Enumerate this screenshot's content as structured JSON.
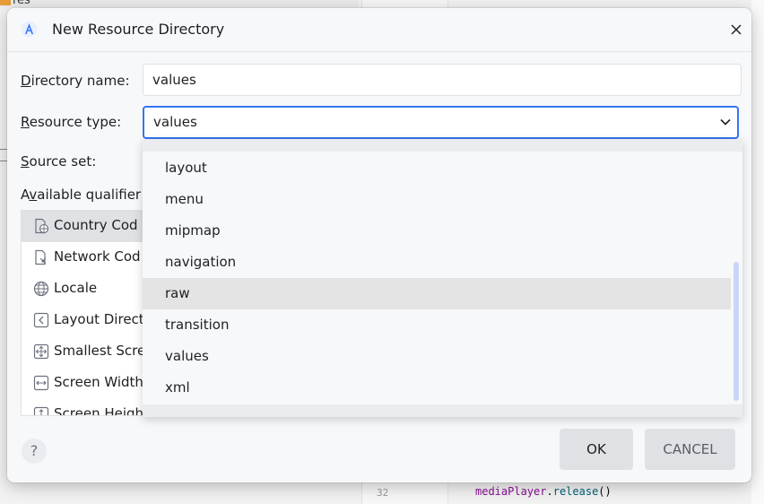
{
  "background": {
    "project_folder": "res",
    "gutter_line_number": "32",
    "code_line": {
      "object": "mediaPlayer",
      "dot": ".",
      "method": "release",
      "parens": "()"
    }
  },
  "dialog": {
    "title": "New Resource Directory",
    "directory_name": {
      "label_u": "D",
      "label_rest": "irectory name:",
      "value": "values"
    },
    "resource_type": {
      "label_u": "R",
      "label_rest": "esource type:",
      "selected": "values"
    },
    "source_set": {
      "label_u": "S",
      "label_rest": "ource set:"
    },
    "available_qualifiers": {
      "label_pre": "A",
      "label_u": "v",
      "label_rest": "ailable qualifier"
    },
    "qualifiers": [
      {
        "label": "Country Cod",
        "icon": "country-code-icon",
        "selected": true
      },
      {
        "label": "Network Cod",
        "icon": "network-code-icon",
        "selected": false
      },
      {
        "label": "Locale",
        "icon": "globe-icon",
        "selected": false
      },
      {
        "label": "Layout Direct",
        "icon": "layout-direction-icon",
        "selected": false
      },
      {
        "label": "Smallest Scre",
        "icon": "smallest-screen-width-icon",
        "selected": false
      },
      {
        "label": "Screen Width",
        "icon": "screen-width-icon",
        "selected": false
      },
      {
        "label": "Screen Heigh",
        "icon": "screen-height-icon",
        "selected": false
      }
    ],
    "dropdown_options": [
      {
        "label": "layout"
      },
      {
        "label": "menu"
      },
      {
        "label": "mipmap"
      },
      {
        "label": "navigation"
      },
      {
        "label": "raw"
      },
      {
        "label": "transition"
      },
      {
        "label": "values"
      },
      {
        "label": "xml"
      }
    ],
    "hovered_option": "raw",
    "help_label": "?",
    "ok_label": "OK",
    "cancel_label": "CANCEL",
    "accent_color": "#3574f0"
  }
}
